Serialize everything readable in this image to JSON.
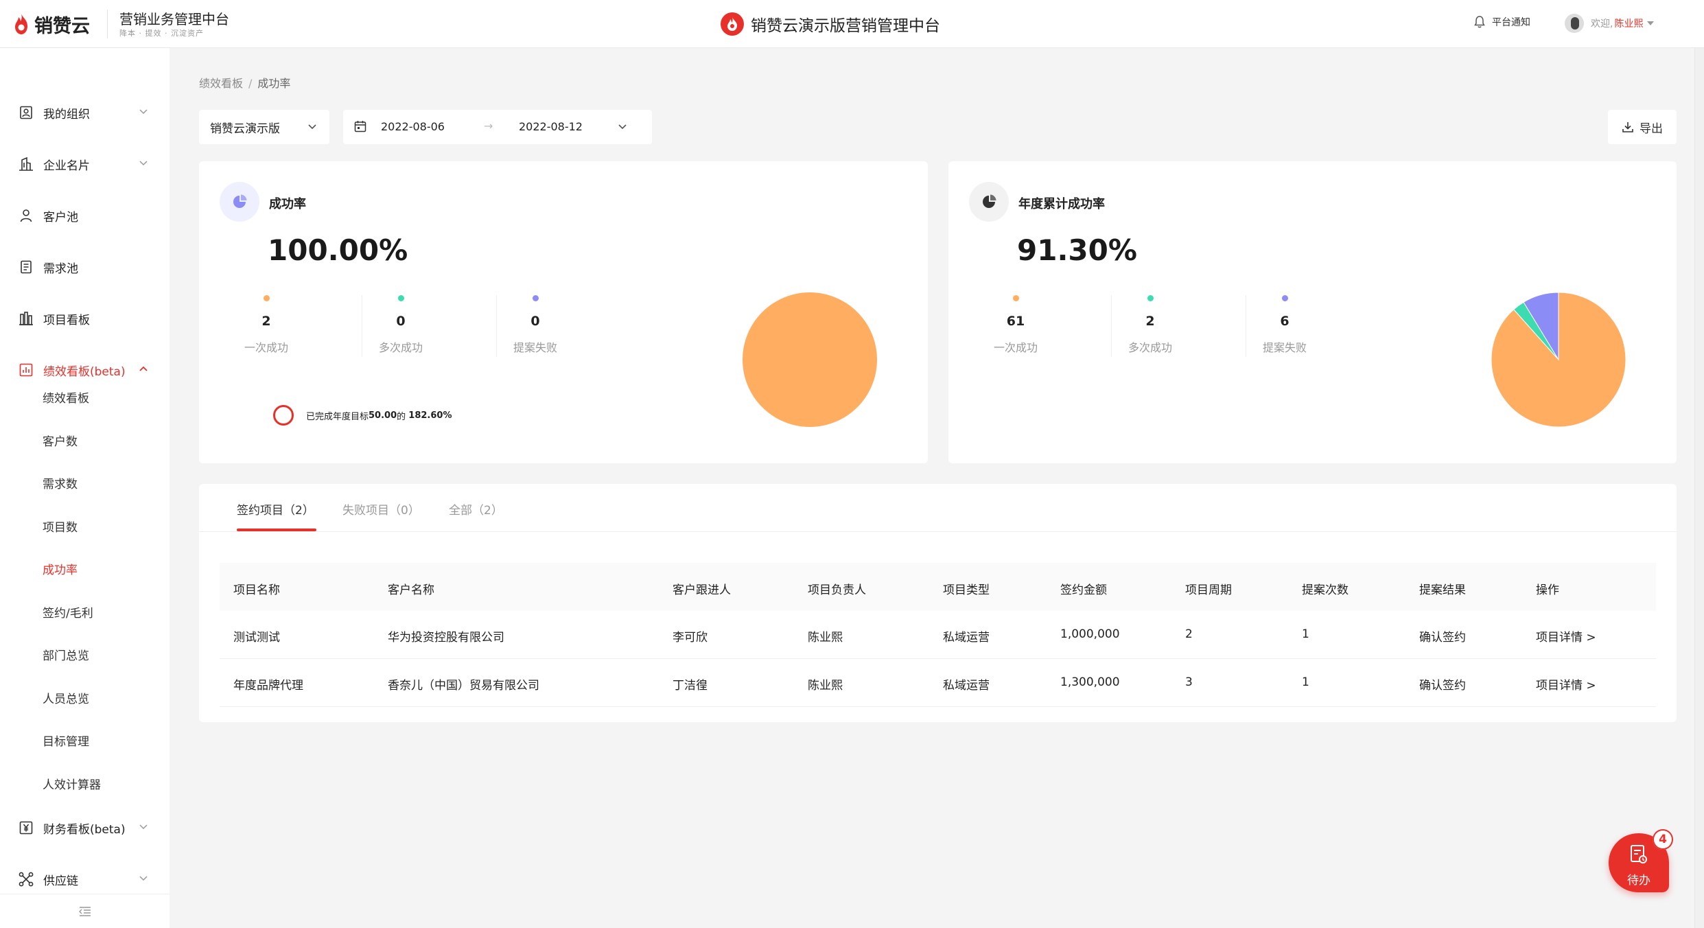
{
  "header": {
    "logo_text": "销赞云",
    "system_title": "营销业务管理中台",
    "system_subtitle": "降本 · 提效 · 沉淀资产",
    "center_title": "销赞云演示版营销管理中台",
    "notify_label": "平台通知",
    "welcome": "欢迎,",
    "user_name": "陈业熙"
  },
  "sidebar": {
    "items": [
      {
        "label": "我的组织",
        "icon": "org-icon"
      },
      {
        "label": "企业名片",
        "icon": "building-icon"
      },
      {
        "label": "客户池",
        "icon": "user-icon"
      },
      {
        "label": "需求池",
        "icon": "document-icon"
      },
      {
        "label": "项目看板",
        "icon": "board-icon"
      },
      {
        "label": "绩效看板(beta)",
        "icon": "chart-icon"
      },
      {
        "label": "财务看板(beta)",
        "icon": "yen-icon"
      },
      {
        "label": "供应链",
        "icon": "network-icon"
      }
    ],
    "sub_items": [
      "绩效看板",
      "客户数",
      "需求数",
      "项目数",
      "成功率",
      "签约/毛利",
      "部门总览",
      "人员总览",
      "目标管理",
      "人效计算器"
    ],
    "active_sub": "成功率"
  },
  "breadcrumb": {
    "parent": "绩效看板",
    "separator": "/",
    "current": "成功率"
  },
  "filters": {
    "company": "销赞云演示版",
    "date_start": "2022-08-06",
    "date_arrow": "→",
    "date_end": "2022-08-12",
    "export_label": "导出"
  },
  "card_success": {
    "title": "成功率",
    "value": "100.00%",
    "stats": [
      {
        "num": "2",
        "label": "一次成功",
        "color": "#ffad60"
      },
      {
        "num": "0",
        "label": "多次成功",
        "color": "#3ddbb0"
      },
      {
        "num": "0",
        "label": "提案失败",
        "color": "#8c8cf6"
      }
    ],
    "goal_prefix": "已完成年度目标",
    "goal_target": "50.00",
    "goal_mid": "的",
    "goal_pct": "182.60%"
  },
  "card_annual": {
    "title": "年度累计成功率",
    "value": "91.30%",
    "stats": [
      {
        "num": "61",
        "label": "一次成功",
        "color": "#ffad60"
      },
      {
        "num": "2",
        "label": "多次成功",
        "color": "#3ddbb0"
      },
      {
        "num": "6",
        "label": "提案失败",
        "color": "#8c8cf6"
      }
    ]
  },
  "chart_data": [
    {
      "type": "pie",
      "categories": [
        "一次成功",
        "多次成功",
        "提案失败"
      ],
      "values": [
        2,
        0,
        0
      ],
      "colors": [
        "#ffad60",
        "#3ddbb0",
        "#8c8cf6"
      ]
    },
    {
      "type": "pie",
      "categories": [
        "一次成功",
        "多次成功",
        "提案失败"
      ],
      "values": [
        61,
        2,
        6
      ],
      "colors": [
        "#ffad60",
        "#3ddbb0",
        "#8c8cf6"
      ]
    }
  ],
  "tabs": [
    {
      "label": "签约项目（2）"
    },
    {
      "label": "失败项目（0）"
    },
    {
      "label": "全部（2）"
    }
  ],
  "table": {
    "columns": [
      "项目名称",
      "客户名称",
      "客户跟进人",
      "项目负责人",
      "项目类型",
      "签约金额",
      "项目周期",
      "提案次数",
      "提案结果",
      "操作"
    ],
    "rows": [
      [
        "测试测试",
        "华为投资控股有限公司",
        "李可欣",
        "陈业熙",
        "私域运营",
        "1,000,000",
        "2",
        "1",
        "确认签约",
        "项目详情 >"
      ],
      [
        "年度品牌代理",
        "香奈儿（中国）贸易有限公司",
        "丁洁徨",
        "陈业熙",
        "私域运营",
        "1,300,000",
        "3",
        "1",
        "确认签约",
        "项目详情 >"
      ]
    ]
  },
  "todo": {
    "label": "待办",
    "count": "4"
  },
  "colors": {
    "accent": "#e8302a",
    "orange": "#ffad60",
    "green": "#3ddbb0",
    "purple": "#8c8cf6"
  }
}
